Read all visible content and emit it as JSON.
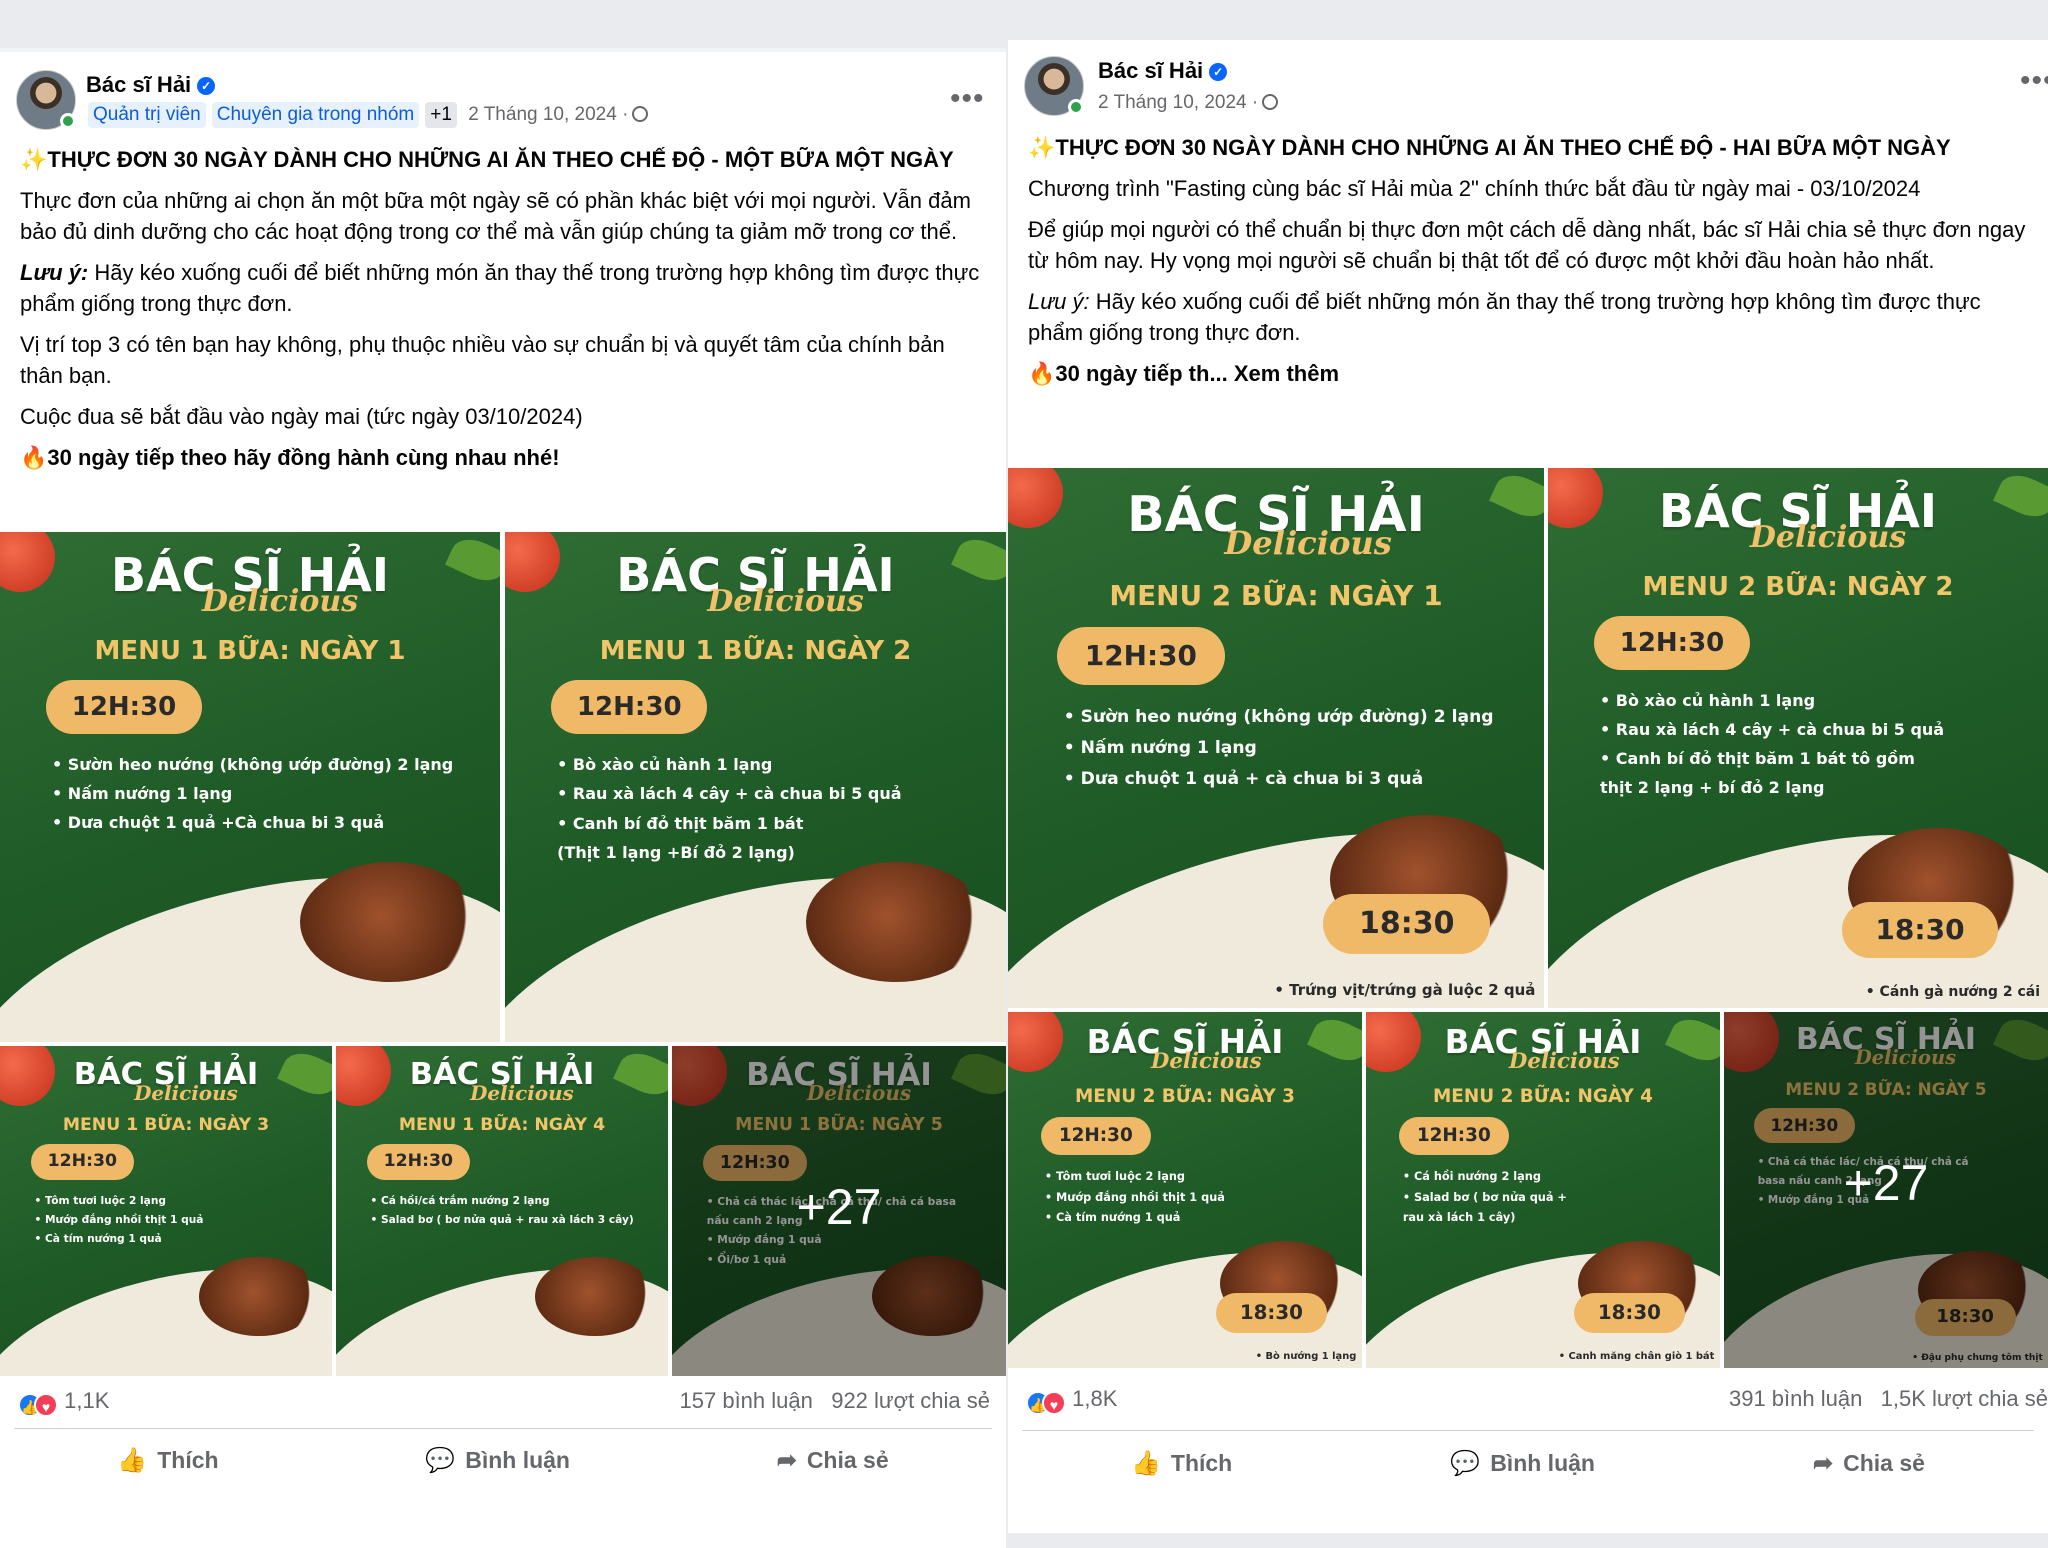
{
  "posts": [
    {
      "author": "Bác sĩ Hải",
      "tags": [
        "Quản trị viên",
        "Chuyên gia trong nhóm",
        "+1"
      ],
      "date": "2 Tháng 10, 2024 ·",
      "more": "•••",
      "title": "THỰC ĐƠN 30 NGÀY DÀNH CHO NHỮNG AI ĂN THEO CHẾ ĐỘ - MỘT BỮA MỘT NGÀY",
      "paragraphs": [
        "Thực đơn của những ai chọn ăn một bữa một ngày sẽ có phần khác biệt với mọi người. Vẫn đảm bảo đủ dinh dưỡng cho các hoạt động trong cơ thể mà vẫn giúp chúng ta giảm mỡ trong cơ thể.",
        "Hãy kéo xuống cuối để biết những món ăn thay thế trong trường hợp không tìm được thực phẩm giống trong thực đơn.",
        "Vị trí top 3 có tên bạn hay không, phụ thuộc nhiều vào sự chuẩn bị và quyết tâm của chính bản thân bạn.",
        "Cuộc đua sẽ bắt đầu vào ngày mai (tức ngày 03/10/2024)"
      ],
      "note_label": "Lưu ý:",
      "cta": "30 ngày tiếp theo hãy đồng hành cùng nhau nhé!",
      "reactions": "1,1K",
      "comments": "157 bình luận",
      "shares": "922 lượt chia sẻ",
      "actions": [
        "Thích",
        "Bình luận",
        "Chia sẻ"
      ],
      "tiles": [
        {
          "brand": "BÁC SĨ HẢI",
          "script": "Delicious",
          "menu": "MENU 1 BỮA: NGÀY 1",
          "time": "12H:30",
          "items": [
            "• Sườn heo nướng (không ướp đường) 2 lạng",
            "• Nấm nướng 1 lạng",
            "• Dưa chuột 1 quả +Cà chua bi 3 quả"
          ]
        },
        {
          "brand": "BÁC SĨ HẢI",
          "script": "Delicious",
          "menu": "MENU 1 BỮA: NGÀY 2",
          "time": "12H:30",
          "items": [
            "• Bò xào củ hành 1 lạng",
            "• Rau xà lách 4 cây + cà chua bi 5 quả",
            "• Canh bí đỏ thịt băm 1 bát",
            "  (Thịt 1 lạng +Bí đỏ 2 lạng)"
          ]
        },
        {
          "brand": "BÁC SĨ HẢI",
          "script": "Delicious",
          "menu": "MENU 1 BỮA: NGÀY 3",
          "time": "12H:30",
          "items": [
            "• Tôm tươi luộc 2 lạng",
            "• Mướp đắng nhồi thịt 1 quả",
            "• Cà tím nướng 1 quả"
          ]
        },
        {
          "brand": "BÁC SĨ HẢI",
          "script": "Delicious",
          "menu": "MENU 1 BỮA: NGÀY 4",
          "time": "12H:30",
          "items": [
            "• Cá hồi/cá trắm nướng 2 lạng",
            "• Salad bơ ( bơ nửa quả + rau xà lách 3 cây)"
          ]
        },
        {
          "brand": "BÁC SĨ HẢI",
          "script": "Delicious",
          "menu": "MENU 1 BỮA: NGÀY 5",
          "time": "12H:30",
          "items": [
            "• Chả cá thác lác/ chả cá thu/ chả cá basa",
            "  nấu canh 2 lạng",
            "• Mướp đắng 1 quả",
            "• Ổi/bơ 1 quả"
          ],
          "plus": "+27"
        }
      ]
    },
    {
      "author": "Bác sĩ Hải",
      "date": "2 Tháng 10, 2024 ·",
      "more": "•••",
      "title": "THỰC ĐƠN 30 NGÀY DÀNH CHO NHỮNG AI ĂN THEO CHẾ ĐỘ - HAI BỮA MỘT NGÀY",
      "paragraphs": [
        "Chương trình \"Fasting cùng bác sĩ Hải mùa 2\" chính thức bắt đầu từ ngày mai - 03/10/2024",
        "Để giúp mọi người có thể chuẩn bị thực đơn một cách dễ dàng nhất, bác sĩ Hải chia sẻ thực đơn ngay từ hôm nay. Hy vọng mọi người sẽ chuẩn bị thật tốt để có được một khởi đầu hoàn hảo nhất.",
        "Hãy kéo xuống cuối để biết những món ăn thay thế trong trường hợp không tìm được thực phẩm giống trong thực đơn."
      ],
      "note_label": "Lưu ý:",
      "cta": "30 ngày tiếp th... Xem thêm",
      "reactions": "1,8K",
      "comments": "391 bình luận",
      "shares": "1,5K lượt chia sẻ",
      "actions": [
        "Thích",
        "Bình luận",
        "Chia sẻ"
      ],
      "tiles": [
        {
          "brand": "BÁC SĨ HẢI",
          "script": "Delicious",
          "menu": "MENU 2 BỮA: NGÀY 1",
          "time": "12H:30",
          "items": [
            "• Sườn heo nướng (không ướp đường)  2 lạng",
            "• Nấm nướng 1 lạng",
            "• Dưa chuột 1 quả + cà chua bi 3 quả"
          ],
          "time2": "18:30",
          "foot": "• Trứng vịt/trứng gà luộc 2 quả"
        },
        {
          "brand": "BÁC SĨ HẢI",
          "script": "Delicious",
          "menu": "MENU 2 BỮA: NGÀY 2",
          "time": "12H:30",
          "items": [
            "• Bò xào củ hành 1 lạng",
            "• Rau xà lách 4 cây + cà chua bi 5 quả",
            "• Canh bí đỏ thịt băm 1 bát tô gồm",
            "   thịt 2 lạng + bí đỏ 2 lạng"
          ],
          "time2": "18:30",
          "foot": "• Cánh gà nướng 2 cái"
        },
        {
          "brand": "BÁC SĨ HẢI",
          "script": "Delicious",
          "menu": "MENU 2 BỮA: NGÀY 3",
          "time": "12H:30",
          "items": [
            "• Tôm tươi luộc 2 lạng",
            "• Mướp đắng nhồi thịt 1 quả",
            "• Cà tím nướng 1 quả"
          ],
          "time2": "18:30",
          "foot": "• Bò nướng 1 lạng"
        },
        {
          "brand": "BÁC SĨ HẢI",
          "script": "Delicious",
          "menu": "MENU 2 BỮA: NGÀY 4",
          "time": "12H:30",
          "items": [
            "• Cá hồi nướng 2 lạng",
            "• Salad bơ ( bơ nửa quả +",
            "  rau xà lách 1 cây)"
          ],
          "time2": "18:30",
          "foot": "• Canh măng chân giò 1 bát"
        },
        {
          "brand": "BÁC SĨ HẢI",
          "script": "Delicious",
          "menu": "MENU 2 BỮA: NGÀY 5",
          "time": "12H:30",
          "items": [
            "• Chả cá thác lác/ chả cá thu/ chả cá",
            "  basa nấu canh 2 lạng",
            "• Mướp đắng 1 quả"
          ],
          "time2": "18:30",
          "foot": "• Đậu phụ chưng tôm thịt",
          "plus": "+27"
        }
      ]
    }
  ]
}
